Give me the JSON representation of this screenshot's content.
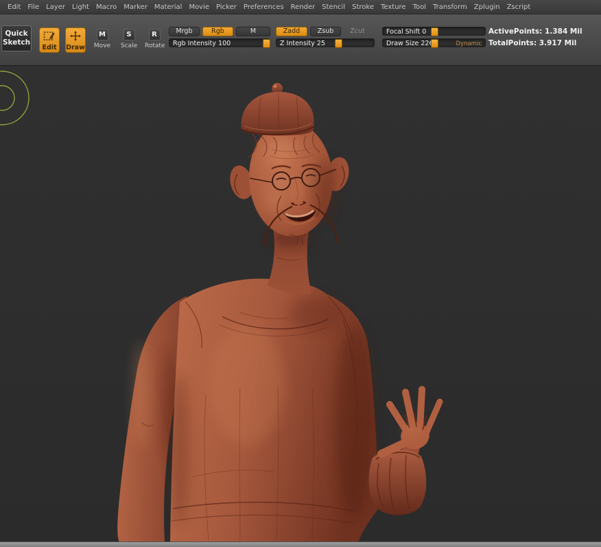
{
  "menu": {
    "items": [
      "Edit",
      "File",
      "Layer",
      "Light",
      "Macro",
      "Marker",
      "Material",
      "Movie",
      "Picker",
      "Preferences",
      "Render",
      "Stencil",
      "Stroke",
      "Texture",
      "Tool",
      "Transform",
      "Zplugin",
      "Zscript"
    ]
  },
  "toolbar": {
    "quick_sketch_label": "Quick Sketch",
    "edit_label": "Edit",
    "draw_label": "Draw",
    "move_label": "Move",
    "move_letter": "M",
    "scale_label": "Scale",
    "scale_letter": "S",
    "rotate_label": "Rotate",
    "rotate_letter": "R",
    "mrgb_label": "Mrgb",
    "rgb_label": "Rgb",
    "m_label": "M",
    "rgb_intensity_label": "Rgb Intensity 100",
    "zadd_label": "Zadd",
    "zsub_label": "Zsub",
    "zcut_label": "Zcut",
    "z_intensity_label": "Z Intensity 25",
    "focal_shift_label": "Focal Shift 0",
    "draw_size_label": "Draw Size 226",
    "dynamic_label": "Dynamic",
    "active_points": "ActivePoints: 1.384 Mil",
    "total_points": "TotalPoints: 3.917 Mil"
  },
  "colors": {
    "accent_orange": "#e59b2b",
    "canvas_bg": "#2e2e2e",
    "clay_base": "#a85a3e",
    "cursor_ring": "#9fae3d"
  }
}
